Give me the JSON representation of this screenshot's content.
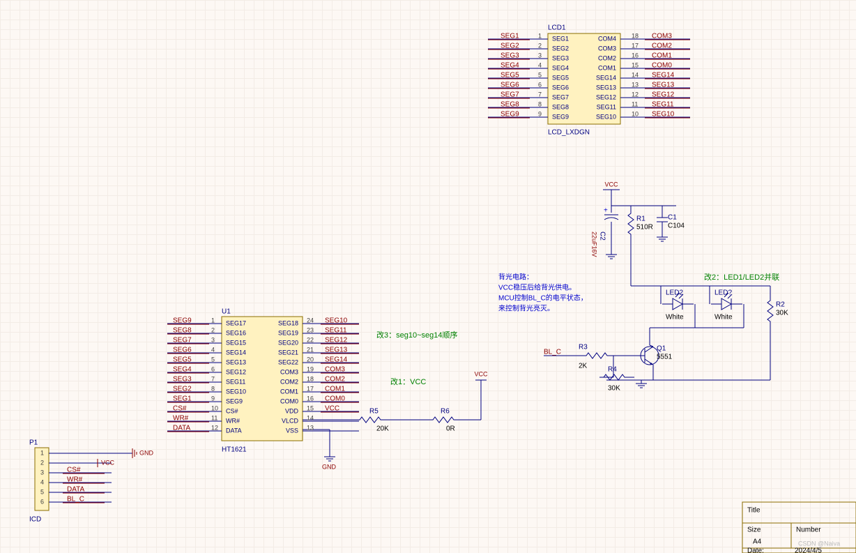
{
  "lcd1": {
    "ref": "LCD1",
    "type": "LCD_LXDGN",
    "left": [
      {
        "n": "1",
        "net": "SEG1",
        "in": "SEG1",
        "in2": "COM4"
      },
      {
        "n": "2",
        "net": "SEG2",
        "in": "SEG2",
        "in2": "COM3"
      },
      {
        "n": "3",
        "net": "SEG3",
        "in": "SEG3",
        "in2": "COM2"
      },
      {
        "n": "4",
        "net": "SEG4",
        "in": "SEG4",
        "in2": "COM1"
      },
      {
        "n": "5",
        "net": "SEG5",
        "in": "SEG5",
        "in2": "SEG14"
      },
      {
        "n": "6",
        "net": "SEG6",
        "in": "SEG6",
        "in2": "SEG13"
      },
      {
        "n": "7",
        "net": "SEG7",
        "in": "SEG7",
        "in2": "SEG12"
      },
      {
        "n": "8",
        "net": "SEG8",
        "in": "SEG8",
        "in2": "SEG11"
      },
      {
        "n": "9",
        "net": "SEG9",
        "in": "SEG9",
        "in2": "SEG10"
      }
    ],
    "right": [
      {
        "n": "18",
        "net": "COM3"
      },
      {
        "n": "17",
        "net": "COM2"
      },
      {
        "n": "16",
        "net": "COM1"
      },
      {
        "n": "15",
        "net": "COM0"
      },
      {
        "n": "14",
        "net": "SEG14"
      },
      {
        "n": "13",
        "net": "SEG13"
      },
      {
        "n": "12",
        "net": "SEG12"
      },
      {
        "n": "11",
        "net": "SEG11"
      },
      {
        "n": "10",
        "net": "SEG10"
      }
    ]
  },
  "u1": {
    "ref": "U1",
    "part": "HT1621",
    "left": [
      {
        "n": "1",
        "net": "SEG9",
        "in": "SEG17"
      },
      {
        "n": "2",
        "net": "SEG8",
        "in": "SEG16"
      },
      {
        "n": "3",
        "net": "SEG7",
        "in": "SEG15"
      },
      {
        "n": "4",
        "net": "SEG6",
        "in": "SEG14"
      },
      {
        "n": "5",
        "net": "SEG5",
        "in": "SEG13"
      },
      {
        "n": "6",
        "net": "SEG4",
        "in": "SEG12"
      },
      {
        "n": "7",
        "net": "SEG3",
        "in": "SEG11"
      },
      {
        "n": "8",
        "net": "SEG2",
        "in": "SEG10"
      },
      {
        "n": "9",
        "net": "SEG1",
        "in": "SEG9"
      },
      {
        "n": "10",
        "net": "CS#",
        "in": "CS#"
      },
      {
        "n": "11",
        "net": "WR#",
        "in": "WR#"
      },
      {
        "n": "12",
        "net": "DATA",
        "in": "DATA"
      }
    ],
    "right": [
      {
        "n": "24",
        "net": "SEG10",
        "in": "SEG18"
      },
      {
        "n": "23",
        "net": "SEG11",
        "in": "SEG19"
      },
      {
        "n": "22",
        "net": "SEG12",
        "in": "SEG20"
      },
      {
        "n": "21",
        "net": "SEG13",
        "in": "SEG21"
      },
      {
        "n": "20",
        "net": "SEG14",
        "in": "SEG22"
      },
      {
        "n": "19",
        "net": "COM3",
        "in": "COM3"
      },
      {
        "n": "18",
        "net": "COM2",
        "in": "COM2"
      },
      {
        "n": "17",
        "net": "COM1",
        "in": "COM1"
      },
      {
        "n": "16",
        "net": "COM0",
        "in": "COM0"
      },
      {
        "n": "15",
        "net": "VCC",
        "in": "VDD"
      },
      {
        "n": "14",
        "net": "",
        "in": "VLCD"
      },
      {
        "n": "13",
        "net": "",
        "in": "VSS"
      }
    ]
  },
  "p1": {
    "ref": "P1",
    "part": "ICD",
    "pins": [
      {
        "n": "1",
        "net": "GND",
        "pwr": "GND"
      },
      {
        "n": "2",
        "net": "VCC",
        "pwr": "VCC"
      },
      {
        "n": "3",
        "net": "CS#"
      },
      {
        "n": "4",
        "net": "WR#"
      },
      {
        "n": "5",
        "net": "DATA"
      },
      {
        "n": "6",
        "net": "BL_C"
      }
    ]
  },
  "powerTop": "VCC",
  "c2": {
    "ref": "C2",
    "val": "22uF16V"
  },
  "r1": {
    "ref": "R1",
    "val": "510R"
  },
  "c1": {
    "ref": "C1",
    "val": "C104"
  },
  "led2": {
    "ref": "LED2",
    "val": "White"
  },
  "led1": {
    "ref": "LED?",
    "val": "White"
  },
  "r2": {
    "ref": "R2",
    "val": "30K"
  },
  "r3": {
    "ref": "R3",
    "val": "2K"
  },
  "r4": {
    "ref": "R4",
    "val": "30K"
  },
  "q1": {
    "ref": "Q1",
    "val": "5551"
  },
  "r5": {
    "ref": "R5",
    "val": "20K"
  },
  "r6": {
    "ref": "R6",
    "val": "0R"
  },
  "blc": "BL_C",
  "gnd": "GND",
  "vcc": "VCC",
  "note_blue": [
    "背光电路：",
    "VCC稳压后给背光供电。",
    "MCU控制BL_C的电平状态，",
    "来控制背光亮灭。"
  ],
  "note_g1": "改3：seg10~seg14顺序",
  "note_g2": "改1：VCC",
  "note_g3": "改2：LED1/LED2并联",
  "title_block": {
    "title": "Title",
    "size": "Size",
    "a4": "A4",
    "number": "Number",
    "date": "Date:",
    "date_val": "2024/4/5"
  },
  "watermark": "CSDN @Naiva"
}
